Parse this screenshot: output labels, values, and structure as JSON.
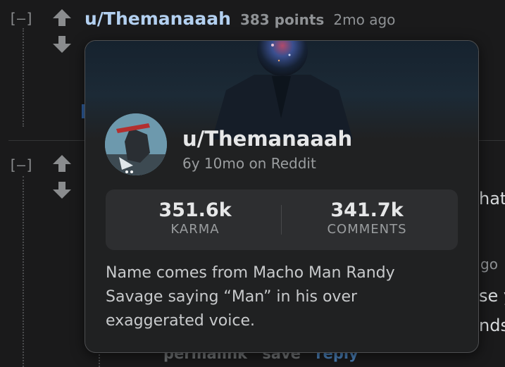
{
  "comment1": {
    "collapse_label": "[–]",
    "author": "u/Themanaaah",
    "points": "383 points",
    "age": "2mo ago"
  },
  "comment2": {
    "collapse_label": "[–]",
    "text_fragment_1": "hat",
    "age_fragment": "go",
    "text_fragment_2": "se y",
    "text_fragment_3": "nds"
  },
  "actions": {
    "permalink": "permalink",
    "save": "save",
    "reply": "reply"
  },
  "profile_card": {
    "username": "u/Themanaaah",
    "account_age": "6y 10mo on Reddit",
    "stats": [
      {
        "value": "351.6k",
        "label": "KARMA"
      },
      {
        "value": "341.7k",
        "label": "COMMENTS"
      }
    ],
    "bio": "Name comes from Macho Man Randy Savage saying “Man” in his over exaggerated voice."
  },
  "colors": {
    "background": "#1a1a1b",
    "card": "#202122",
    "stats_panel": "#2d2e30",
    "author_link": "#b3d0f0",
    "reply_link": "#4a7fb7"
  },
  "icons": {
    "upvote": "arrow-up-icon",
    "downvote": "arrow-down-icon"
  }
}
